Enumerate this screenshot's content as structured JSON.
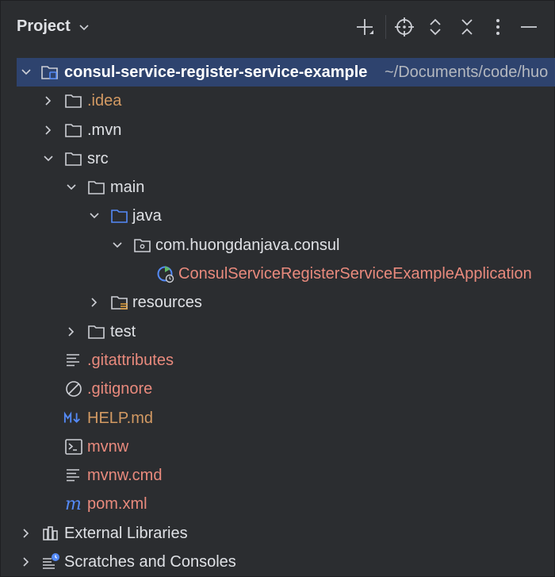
{
  "header": {
    "title": "Project",
    "icons": [
      "plus-icon",
      "locate-icon",
      "expand-all-icon",
      "collapse-all-icon",
      "more-icon",
      "minimize-icon"
    ]
  },
  "tree": {
    "root": {
      "name": "consul-service-register-service-example",
      "path": "~/Documents/code/huo"
    },
    "idea": ".idea",
    "mvn": ".mvn",
    "src": "src",
    "main": "main",
    "java": "java",
    "package": "com.huongdanjava.consul",
    "app_class": "ConsulServiceRegisterServiceExampleApplication",
    "resources": "resources",
    "test": "test",
    "gitattributes": ".gitattributes",
    "gitignore": ".gitignore",
    "help": "HELP.md",
    "mvnw": "mvnw",
    "mvnw_cmd": "mvnw.cmd",
    "pom": "pom.xml",
    "external_libraries": "External Libraries",
    "scratches": "Scratches and Consoles"
  },
  "colors": {
    "background": "#2b2d30",
    "selection": "#2e436e",
    "ignored_file": "#d39a63",
    "untracked_file": "#e98a7d",
    "icon": "#ced0d6",
    "source_folder": "#548af7"
  }
}
